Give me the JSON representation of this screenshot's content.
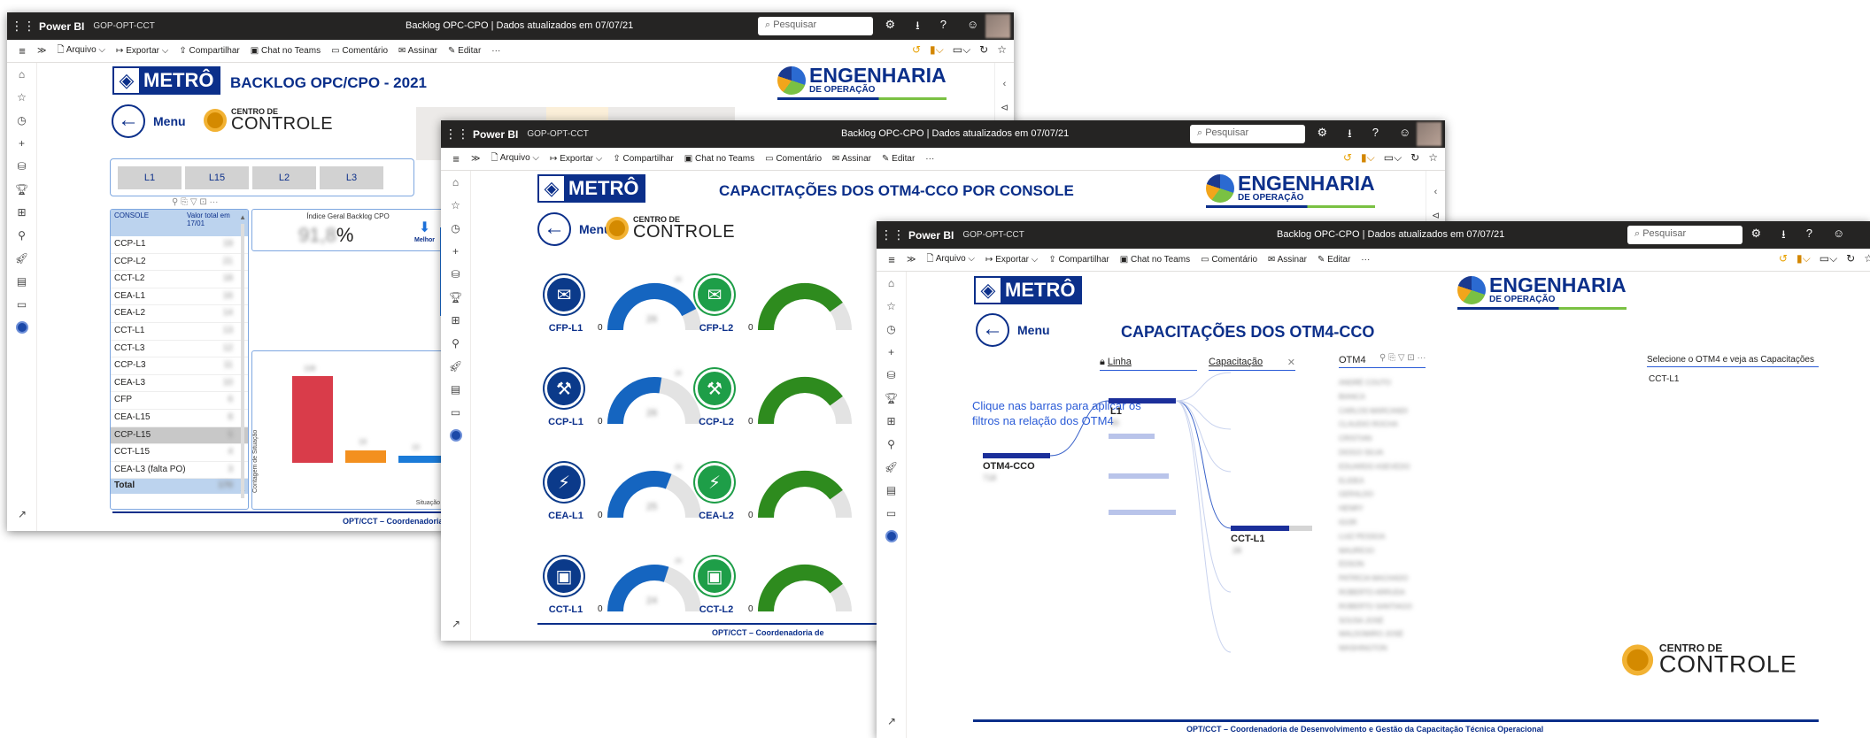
{
  "common": {
    "brand": "Power BI",
    "workspace": "GOP-OPT-CCT",
    "report_title": "Backlog OPC-CPO  |  Dados atualizados em 07/07/21",
    "search_placeholder": "Pesquisar",
    "toolbar": {
      "file": "Arquivo",
      "export": "Exportar",
      "share": "Compartilhar",
      "teams": "Chat no Teams",
      "comment": "Comentário",
      "subscribe": "Assinar",
      "edit": "Editar",
      "more": "···"
    },
    "metro_text": "METRÔ",
    "eng_title": "ENGENHARIA",
    "eng_sub": "DE OPERAÇÃO",
    "menu_label": "Menu",
    "cc_small": "CENTRO DE",
    "cc_big": "CONTROLE"
  },
  "w1": {
    "title": "BACKLOG OPC/CPO - 2021",
    "lines": [
      "L1",
      "L15",
      "L2",
      "L3"
    ],
    "table": {
      "header_console": "CONSOLE",
      "header_value": "Valor total em 17/01",
      "rows": [
        {
          "name": "CCP-L1",
          "value": "19"
        },
        {
          "name": "CCP-L2",
          "value": "21"
        },
        {
          "name": "CCT-L2",
          "value": "18"
        },
        {
          "name": "CEA-L1",
          "value": "16"
        },
        {
          "name": "CEA-L2",
          "value": "14"
        },
        {
          "name": "CCT-L1",
          "value": "13"
        },
        {
          "name": "CCT-L3",
          "value": "12"
        },
        {
          "name": "CCP-L3",
          "value": "11"
        },
        {
          "name": "CEA-L3",
          "value": "10"
        },
        {
          "name": "CFP",
          "value": "6"
        },
        {
          "name": "CEA-L15",
          "value": "8"
        },
        {
          "name": "CCP-L15",
          "value": "5"
        },
        {
          "name": "CCT-L15",
          "value": "4"
        },
        {
          "name": "CEA-L3 (falta PO)",
          "value": "3"
        }
      ],
      "total_label": "Total",
      "total_value": "170"
    },
    "kpi_title": "Índice Geral Backlog CPO",
    "kpi_value": "91,8",
    "kpi_unit": "%",
    "kpi_better": "Melhor",
    "chart_ylabel": "Contagem de Situação",
    "chart_xlabel": "Situação",
    "footer": "OPT/CCT – Coordenadoria d"
  },
  "w2": {
    "title": "CAPACITAÇÕES DOS OTM4-CCO POR CONSOLE",
    "gauges": [
      {
        "label": "CFP-L1",
        "min": "0",
        "value": "26",
        "max": "28",
        "fill": 0.85,
        "color": "#1565c0"
      },
      {
        "label": "CCP-L1",
        "min": "0",
        "value": "26",
        "max": "28",
        "fill": 0.55,
        "color": "#1565c0"
      },
      {
        "label": "CEA-L1",
        "min": "0",
        "value": "25",
        "max": "29",
        "fill": 0.62,
        "color": "#1565c0"
      },
      {
        "label": "CCT-L1",
        "min": "0",
        "value": "24",
        "max": "28",
        "fill": 0.6,
        "color": "#1565c0"
      },
      {
        "label": "CFP-L2",
        "min": "0",
        "value": "",
        "max": "",
        "fill": 0.8,
        "color": "#2e8b1e"
      },
      {
        "label": "CCP-L2",
        "min": "0",
        "value": "",
        "max": "",
        "fill": 0.8,
        "color": "#2e8b1e"
      },
      {
        "label": "CEA-L2",
        "min": "0",
        "value": "",
        "max": "",
        "fill": 0.8,
        "color": "#2e8b1e"
      },
      {
        "label": "CCT-L2",
        "min": "0",
        "value": "",
        "max": "",
        "fill": 0.8,
        "color": "#2e8b1e"
      }
    ],
    "footer": "OPT/CCT – Coordenadoria de"
  },
  "w3": {
    "title": "CAPACITAÇÕES DOS OTM4-CCO",
    "instruction": "Clique nas barras para aplicar os filtros na relação dos OTM4",
    "slicer_line": "Linha",
    "slicer_cap": "Capacitação",
    "otm4_header": "OTM4",
    "select_header": "Selecione o OTM4 e veja as Capacitações",
    "select_value": "CCT-L1",
    "root_label": "OTM4-CCO",
    "root_value": "718",
    "l1_label": "L1",
    "l1_value": "95",
    "cct_label": "CCT-L1",
    "cct_value": "28",
    "otm4_names": [
      "ANDRÉ COUTO",
      "BIANCA",
      "CARLOS MARCANDI",
      "CLAUDIO ROCHA",
      "CRISTIAN",
      "DIOGO SILVA",
      "EDUARDO ASEVEDO",
      "ELIDEA",
      "GERALDO",
      "HENRY",
      "IGOR",
      "LUIZ PESSOA",
      "MAURÍCIO",
      "ÉDSON",
      "PATRÍCIA MACHADO",
      "ROBERTO ARRUDA",
      "ROBERTO SANTIAGO",
      "SOUSA JOSÉ",
      "WALDOMIRO JOSÉ",
      "WASHINGTON"
    ],
    "footer": "OPT/CCT – Coordenadoria de Desenvolvimento e Gestão da Capacitação Técnica Operacional"
  }
}
